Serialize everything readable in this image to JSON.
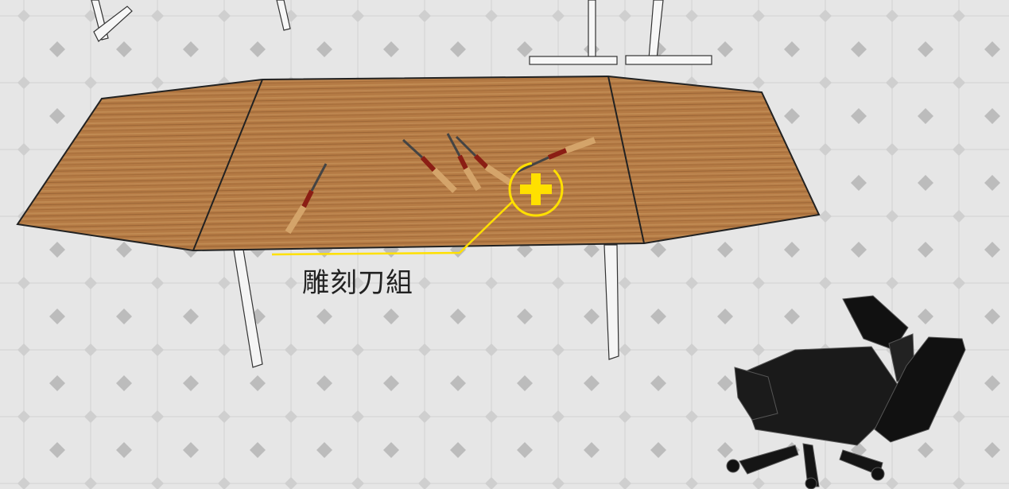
{
  "annotation": {
    "label": "雕刻刀組",
    "accent_color": "#ffe000",
    "icon": "add-target-icon"
  },
  "scene": {
    "floor_color": "#e6e6e6",
    "tile_mark_color": "#bdbdbd",
    "table_color": "#b07840",
    "chair_color": "#111111"
  }
}
